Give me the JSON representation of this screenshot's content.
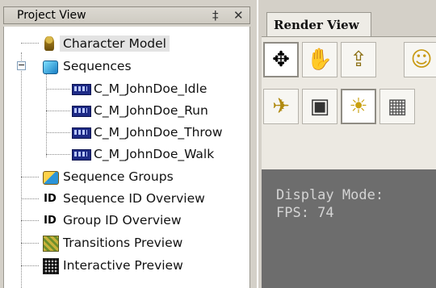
{
  "project_view": {
    "title": "Project View",
    "pin_glyph": "‡",
    "close_glyph": "✕",
    "tree": [
      {
        "label": "Character Model",
        "icon": "character-icon"
      },
      {
        "label": "Sequences",
        "icon": "cube-icon",
        "expanded": true,
        "expander": "−"
      },
      {
        "label": "C_M_JohnDoe_Idle",
        "icon": "film-icon"
      },
      {
        "label": "C_M_JohnDoe_Run",
        "icon": "film-icon"
      },
      {
        "label": "C_M_JohnDoe_Throw",
        "icon": "film-icon"
      },
      {
        "label": "C_M_JohnDoe_Walk",
        "icon": "film-icon"
      },
      {
        "label": "Sequence Groups",
        "icon": "group-icon"
      },
      {
        "label": "Sequence ID Overview",
        "icon": "id-icon",
        "icon_text": "ID"
      },
      {
        "label": "Group ID Overview",
        "icon": "id-icon",
        "icon_text": "ID"
      },
      {
        "label": "Transitions Preview",
        "icon": "transitions-icon"
      },
      {
        "label": "Interactive Preview",
        "icon": "interactive-icon"
      }
    ]
  },
  "render_view": {
    "tab_label": "Render View",
    "tools_row1": [
      {
        "name": "move-tool",
        "glyph": "✥"
      },
      {
        "name": "hand-tool",
        "glyph": "✋"
      },
      {
        "name": "up-arrow-grid-tool",
        "glyph": "⇪"
      },
      {
        "name": "character-select-tool",
        "glyph": "☺"
      }
    ],
    "tools_row2": [
      {
        "name": "walk-tool",
        "glyph": "✈"
      },
      {
        "name": "wireframe-cube-tool",
        "glyph": "▣"
      },
      {
        "name": "spotlight-tool",
        "glyph": "☀"
      },
      {
        "name": "floor-grid-tool",
        "glyph": "▦"
      }
    ],
    "display_mode_text": "Display Mode:",
    "fps_text": "FPS: 74"
  },
  "colors": {
    "panel_bg": "#d4d0c8",
    "tree_bg": "#ffffff",
    "viewport_bg": "#6d6d6d",
    "viewport_text": "#d4d4d4"
  }
}
